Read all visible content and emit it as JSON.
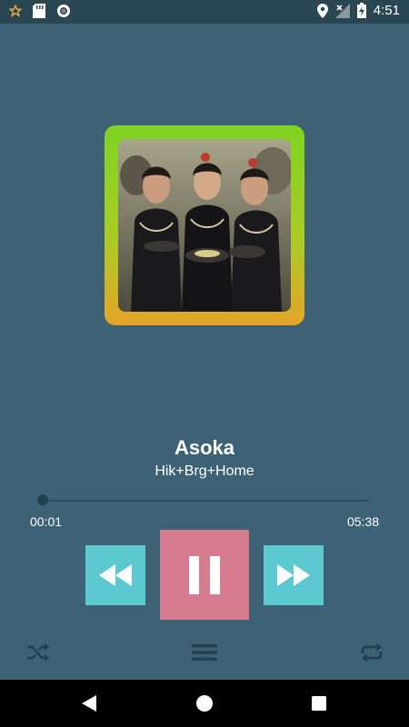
{
  "status_bar": {
    "time": "4:51",
    "left_icons": [
      "star-icon",
      "sd-card-icon",
      "circle-record-icon"
    ],
    "right_icons": [
      "location-icon",
      "no-signal-icon",
      "battery-charging-icon"
    ]
  },
  "now_playing": {
    "title": "Asoka",
    "artist": "Hik+Brg+Home",
    "current_time": "00:01",
    "total_time": "05:38",
    "progress": 0.003
  },
  "controls": {
    "rewind_icon": "rewind-icon",
    "pause_icon": "pause-icon",
    "forward_icon": "fast-forward-icon",
    "shuffle_icon": "shuffle-icon",
    "playlist_icon": "playlist-icon",
    "repeat_icon": "repeat-icon"
  },
  "colors": {
    "background": "#3d6275",
    "status_bar": "#2b4653",
    "accent_teal": "#5cc8cf",
    "accent_pink": "#d57d8e",
    "album_gradient_top": "#7fd321",
    "album_gradient_bottom": "#e6a528"
  },
  "nav_bar": {
    "icons": [
      "back-icon",
      "home-icon",
      "recents-icon"
    ]
  }
}
